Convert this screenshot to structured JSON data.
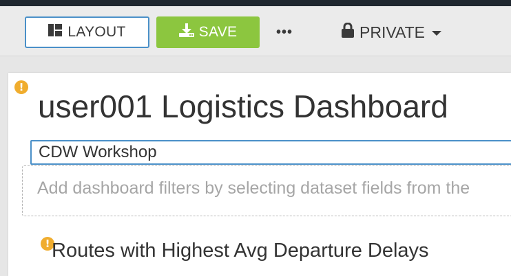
{
  "toolbar": {
    "layout_label": "LAYOUT",
    "layout_icon": "layout-grid-icon",
    "save_label": "SAVE",
    "save_icon": "download-icon",
    "more_label": "•••",
    "privacy_label": "PRIVATE",
    "privacy_icon": "lock-icon",
    "colors": {
      "save_bg": "#8cc63f",
      "layout_border": "#4a90c8"
    }
  },
  "dashboard": {
    "title": "user001 Logistics Dashboard",
    "subtitle_value": "CDW Workshop",
    "filter_placeholder": "Add dashboard filters by selecting dataset fields from the",
    "warning_icon": "warning-icon",
    "warning_color": "#f0ad2e"
  },
  "visual": {
    "title": "Routes with Highest Avg Departure Delays"
  }
}
